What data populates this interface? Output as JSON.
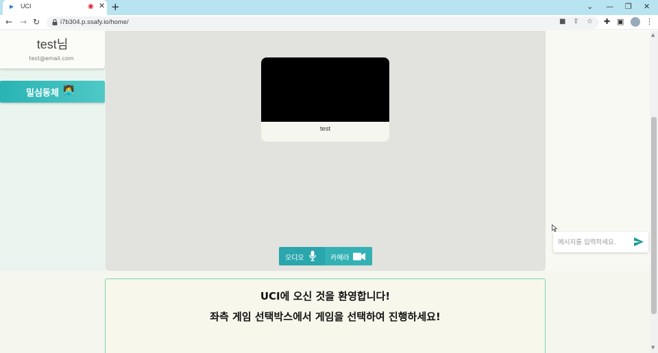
{
  "browser": {
    "tab_title": "UCI",
    "new_tab": "+",
    "url": "i7b304.p.ssafy.io/home/",
    "window_controls": {
      "dropdown": "⌄",
      "minimize": "—",
      "restore": "❐",
      "close": "✕"
    }
  },
  "sidebar": {
    "username": "test님",
    "email": "test@email.com",
    "channel_button": {
      "label": "밀심동체",
      "emoji": "👩‍💻"
    }
  },
  "stage": {
    "participant_name": "test",
    "controls": {
      "audio_label": "오디오",
      "camera_label": "카메라"
    }
  },
  "chat": {
    "placeholder": "메시지를 입력하세요."
  },
  "welcome": {
    "line1": "UCI에 오신 것을 환영합니다!",
    "line2": "좌측 게임 선택박스에서 게임을 선택하여 진행하세요!"
  },
  "colors": {
    "accent": "#2aa6ad",
    "accent_light": "#4ec9c6",
    "welcome_border": "#7fd0b6"
  }
}
